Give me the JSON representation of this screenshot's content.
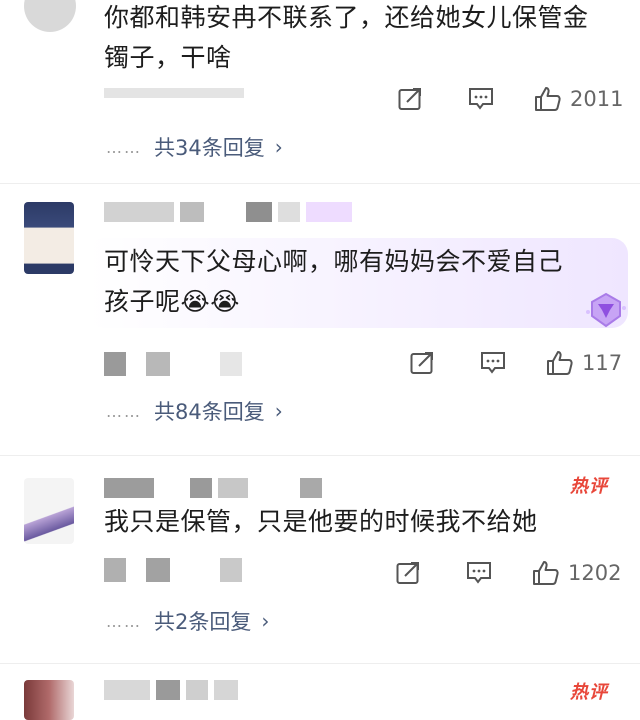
{
  "comments": [
    {
      "text_line1": "你都和韩安冉不联系了，还给她女儿保管金",
      "text_line2": "镯子，干啥",
      "like_count": "2011",
      "reply_link": "共34条回复"
    },
    {
      "text_line1": "可怜天下父母心啊，哪有妈妈会不爱自己",
      "text_line2": "孩子呢😭😭",
      "like_count": "117",
      "reply_link": "共84条回复"
    },
    {
      "hot_badge": "热评",
      "text_line1": "我只是保管，只是他要的时候我不给她",
      "like_count": "1202",
      "reply_link": "共2条回复"
    },
    {
      "hot_badge": "热评"
    }
  ],
  "reply_dots": "……",
  "reply_chevron": "›",
  "icons": [
    "share-icon",
    "comment-icon",
    "like-icon",
    "chevron-right-icon",
    "gem-badge-icon"
  ],
  "colors": {
    "hot_badge": "#e8473a",
    "reply_link": "#4a5b7a",
    "icon_stroke": "#555555",
    "bubble_tint": "#efe6ff"
  }
}
